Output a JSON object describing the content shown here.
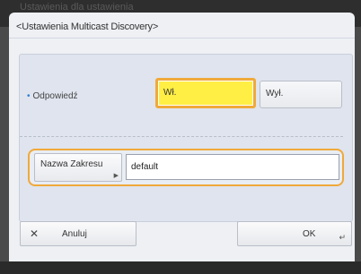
{
  "background": {
    "header_text": "Ustawienia dla ustawienia"
  },
  "dialog": {
    "title": "<Ustawienia Multicast Discovery>"
  },
  "response": {
    "label": "Odpowiedź",
    "on_label": "Wł.",
    "off_label": "Wył.",
    "selected": "on"
  },
  "scope": {
    "button_label": "Nazwa Zakresu",
    "value": "default"
  },
  "footer": {
    "cancel_label": "Anuluj",
    "ok_label": "OK"
  },
  "colors": {
    "selected_fill": "#ffee44",
    "focus_outline": "#f0a93a",
    "bullet": "#2f7fd0"
  }
}
